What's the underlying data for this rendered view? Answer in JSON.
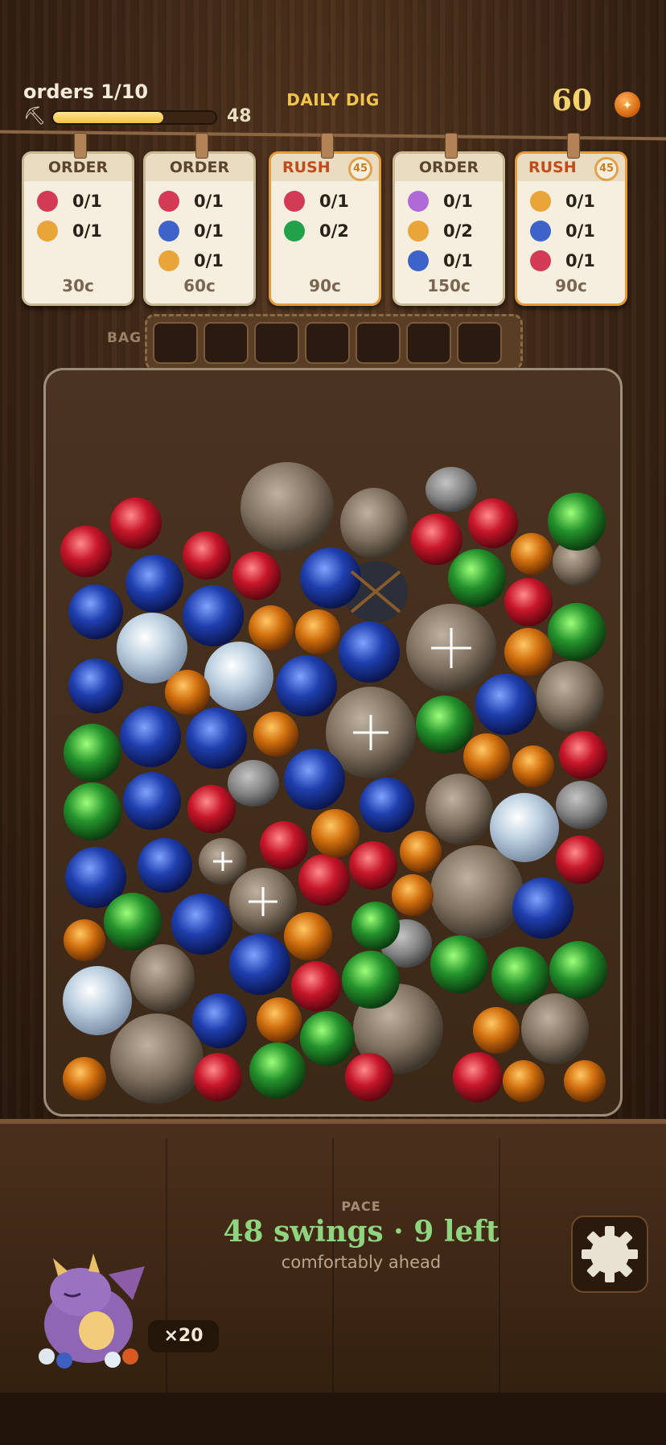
{
  "header": {
    "orders_label": "orders 1/10",
    "pickaxe_icon": "pickaxe-icon",
    "progress_value": 48,
    "progress_fraction": 0.68,
    "mode_title": "DAILY DIG",
    "coins": "60",
    "coin_icon": "coin-icon"
  },
  "colors": {
    "red": "#d33a54",
    "orange": "#eaa53a",
    "blue": "#3d63c8",
    "green": "#23a14a",
    "purple": "#b06ad6"
  },
  "orders": [
    {
      "type": "ORDER",
      "timer": "",
      "items": [
        {
          "color": "#d33a54",
          "count": "0/1"
        },
        {
          "color": "#eaa53a",
          "count": "0/1"
        }
      ],
      "price": "30c"
    },
    {
      "type": "ORDER",
      "timer": "",
      "items": [
        {
          "color": "#d33a54",
          "count": "0/1"
        },
        {
          "color": "#3d63c8",
          "count": "0/1"
        },
        {
          "color": "#eaa53a",
          "count": "0/1"
        }
      ],
      "price": "60c"
    },
    {
      "type": "RUSH",
      "timer": "45",
      "items": [
        {
          "color": "#d33a54",
          "count": "0/1"
        },
        {
          "color": "#23a14a",
          "count": "0/2"
        }
      ],
      "price": "90c"
    },
    {
      "type": "ORDER",
      "timer": "",
      "items": [
        {
          "color": "#b06ad6",
          "count": "0/1"
        },
        {
          "color": "#eaa53a",
          "count": "0/2"
        },
        {
          "color": "#3d63c8",
          "count": "0/1"
        }
      ],
      "price": "150c"
    },
    {
      "type": "RUSH",
      "timer": "45",
      "items": [
        {
          "color": "#eaa53a",
          "count": "0/1"
        },
        {
          "color": "#3d63c8",
          "count": "0/1"
        },
        {
          "color": "#d33a54",
          "count": "0/1"
        }
      ],
      "price": "90c"
    }
  ],
  "bag": {
    "label": "BAG",
    "slots": 7
  },
  "pace": {
    "label": "PACE",
    "main": "48 swings · 9 left",
    "sub": "comfortably ahead"
  },
  "multiplier": "×20",
  "settings_icon": "gear-icon",
  "mascot_icon": "dragon-icon"
}
